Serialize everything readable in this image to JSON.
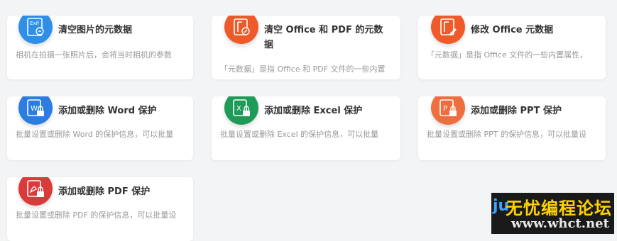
{
  "cards": [
    {
      "title": "清空图片的元数据",
      "desc": "相机在拍摄一张照片后，会将当时相机的参数",
      "color": "#2f8fe8",
      "icon": "exif-image-icon",
      "icon_text": "Exif"
    },
    {
      "title": "清空 Office 和 PDF 的元数据",
      "desc": "「元数据」是指 Office 和 PDF 文件的一些内置",
      "color": "#ee5a2a",
      "icon": "office-pdf-clean-icon"
    },
    {
      "title": "修改 Office 元数据",
      "desc": "「元数据」是指 Office 文件的一些内置属性，",
      "color": "#ee5a2a",
      "icon": "office-edit-icon"
    },
    {
      "title": "添加或删除 Word 保护",
      "desc": "批量设置或删除 Word 的保护信息，可以批量",
      "color": "#2b7de0",
      "icon": "word-lock-icon",
      "icon_text": "W"
    },
    {
      "title": "添加或删除 Excel 保护",
      "desc": "批量设置或删除 Excel 的保护信息，可以批量",
      "color": "#1f9a57",
      "icon": "excel-lock-icon",
      "icon_text": "X"
    },
    {
      "title": "添加或删除 PPT 保护",
      "desc": "批量设置或删除 PPT 的保护信息，可以批量设",
      "color": "#ee6e3f",
      "icon": "ppt-lock-icon",
      "icon_text": "P"
    },
    {
      "title": "添加或删除 PDF 保护",
      "desc": "批量设置或删除 PDF 的保护信息，可以批量设",
      "color": "#d93a3a",
      "icon": "pdf-lock-icon"
    }
  ],
  "watermark": {
    "main": "无忧编程论坛",
    "url": "www.whct.net",
    "logo": "ju"
  }
}
